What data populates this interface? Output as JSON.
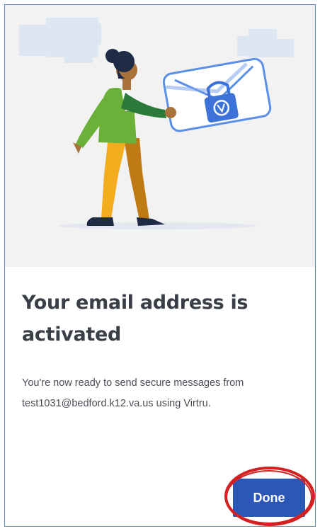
{
  "dialog": {
    "title": "Your email address is activated",
    "message": "You're now ready to send secure messages from test1031@bedford.k12.va.us using Virtru.",
    "done_label": "Done"
  },
  "colors": {
    "accent": "#2b57b6",
    "highlight_ring": "#d42020",
    "illustration_background": "#f2f2f2"
  },
  "icons": {
    "envelope": "envelope-lock-icon",
    "lock": "padlock-icon"
  }
}
